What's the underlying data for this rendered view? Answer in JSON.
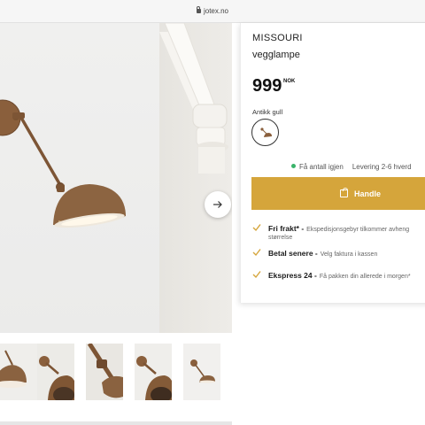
{
  "browser": {
    "url": "jotex.no"
  },
  "product": {
    "brand": "MISSOURI",
    "type": "vegglampe",
    "price": "999",
    "currency": "NOK",
    "variant_label": "Antikk gull",
    "selected_swatch": "antikk-gull",
    "stock_text": "Få antall igjen",
    "delivery_text": "Levering 2-6 hverd",
    "buy_label": "Handle"
  },
  "benefits": [
    {
      "title": "Fri frakt* -",
      "detail": "Ekspedisjonsgebyr tilkommer avheng",
      "detail2": "størrelse"
    },
    {
      "title": "Betal senere -",
      "detail": "Velg faktura i kassen"
    },
    {
      "title": "Ekspress 24 -",
      "detail": "Få pakken din allerede i morgen*"
    }
  ],
  "colors": {
    "accent": "#d5a53b",
    "stock_ok": "#3ab36a",
    "check": "#d5a53b",
    "lamp": "#8a5f3c"
  },
  "icons": {
    "lock": "lock-icon",
    "next": "arrow-right-icon",
    "bag": "shopping-bag-icon",
    "check": "check-icon"
  }
}
